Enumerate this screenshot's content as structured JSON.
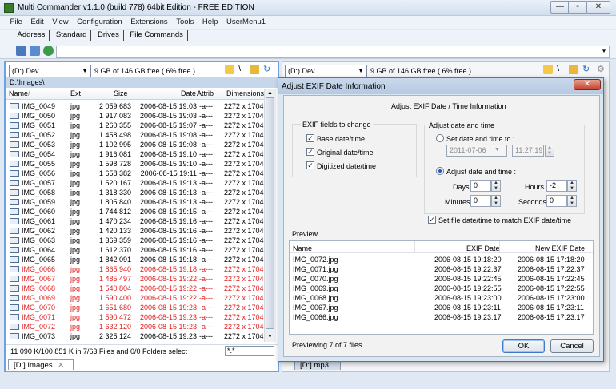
{
  "window": {
    "title": "Multi Commander v1.1.0 (build 778) 64bit Edition - FREE EDITION",
    "min_glyph": "—",
    "max_glyph": "▫",
    "close_glyph": "✕"
  },
  "menu": [
    "File",
    "Edit",
    "View",
    "Configuration",
    "Extensions",
    "Tools",
    "Help",
    "UserMenu1"
  ],
  "toolbar_tabs": [
    "Address",
    "Standard",
    "Drives",
    "File Commands"
  ],
  "left_panel": {
    "drive": "(D:) Dev",
    "free": "9 GB of 146 GB free ( 6% free )",
    "path": "D:\\Images\\",
    "columns": [
      "Name",
      "Ext",
      "Size",
      "Date",
      "Attrib",
      "Dimensions"
    ],
    "sort_glyph": "/",
    "files": [
      {
        "name": "IMG_0049",
        "ext": "jpg",
        "size": "2 059 683",
        "date": "2006-08-15 19:03",
        "attrib": "-a---",
        "dim": "2272 x 1704",
        "red": false
      },
      {
        "name": "IMG_0050",
        "ext": "jpg",
        "size": "1 917 083",
        "date": "2006-08-15 19:03",
        "attrib": "-a---",
        "dim": "2272 x 1704",
        "red": false
      },
      {
        "name": "IMG_0051",
        "ext": "jpg",
        "size": "1 260 355",
        "date": "2006-08-15 19:07",
        "attrib": "-a---",
        "dim": "2272 x 1704",
        "red": false
      },
      {
        "name": "IMG_0052",
        "ext": "jpg",
        "size": "1 458 498",
        "date": "2006-08-15 19:08",
        "attrib": "-a---",
        "dim": "2272 x 1704",
        "red": false
      },
      {
        "name": "IMG_0053",
        "ext": "jpg",
        "size": "1 102 995",
        "date": "2006-08-15 19:08",
        "attrib": "-a---",
        "dim": "2272 x 1704",
        "red": false
      },
      {
        "name": "IMG_0054",
        "ext": "jpg",
        "size": "1 916 081",
        "date": "2006-08-15 19:10",
        "attrib": "-a---",
        "dim": "2272 x 1704",
        "red": false
      },
      {
        "name": "IMG_0055",
        "ext": "jpg",
        "size": "1 598 728",
        "date": "2006-08-15 19:10",
        "attrib": "-a---",
        "dim": "2272 x 1704",
        "red": false
      },
      {
        "name": "IMG_0056",
        "ext": "jpg",
        "size": "1 658 382",
        "date": "2006-08-15 19:11",
        "attrib": "-a---",
        "dim": "2272 x 1704",
        "red": false
      },
      {
        "name": "IMG_0057",
        "ext": "jpg",
        "size": "1 520 167",
        "date": "2006-08-15 19:13",
        "attrib": "-a---",
        "dim": "2272 x 1704",
        "red": false
      },
      {
        "name": "IMG_0058",
        "ext": "jpg",
        "size": "1 318 330",
        "date": "2006-08-15 19:13",
        "attrib": "-a---",
        "dim": "2272 x 1704",
        "red": false
      },
      {
        "name": "IMG_0059",
        "ext": "jpg",
        "size": "1 805 840",
        "date": "2006-08-15 19:13",
        "attrib": "-a---",
        "dim": "2272 x 1704",
        "red": false
      },
      {
        "name": "IMG_0060",
        "ext": "jpg",
        "size": "1 744 812",
        "date": "2006-08-15 19:15",
        "attrib": "-a---",
        "dim": "2272 x 1704",
        "red": false
      },
      {
        "name": "IMG_0061",
        "ext": "jpg",
        "size": "1 470 234",
        "date": "2006-08-15 19:16",
        "attrib": "-a---",
        "dim": "2272 x 1704",
        "red": false
      },
      {
        "name": "IMG_0062",
        "ext": "jpg",
        "size": "1 420 133",
        "date": "2006-08-15 19:16",
        "attrib": "-a---",
        "dim": "2272 x 1704",
        "red": false
      },
      {
        "name": "IMG_0063",
        "ext": "jpg",
        "size": "1 369 359",
        "date": "2006-08-15 19:16",
        "attrib": "-a---",
        "dim": "2272 x 1704",
        "red": false
      },
      {
        "name": "IMG_0064",
        "ext": "jpg",
        "size": "1 612 370",
        "date": "2006-08-15 19:16",
        "attrib": "-a---",
        "dim": "2272 x 1704",
        "red": false
      },
      {
        "name": "IMG_0065",
        "ext": "jpg",
        "size": "1 842 091",
        "date": "2006-08-15 19:18",
        "attrib": "-a---",
        "dim": "2272 x 1704",
        "red": false
      },
      {
        "name": "IMG_0066",
        "ext": "jpg",
        "size": "1 865 940",
        "date": "2006-08-15 19:18",
        "attrib": "-a---",
        "dim": "2272 x 1704",
        "red": true
      },
      {
        "name": "IMG_0067",
        "ext": "jpg",
        "size": "1 485 497",
        "date": "2006-08-15 19:22",
        "attrib": "-a---",
        "dim": "2272 x 1704",
        "red": true
      },
      {
        "name": "IMG_0068",
        "ext": "jpg",
        "size": "1 540 804",
        "date": "2006-08-15 19:22",
        "attrib": "-a---",
        "dim": "2272 x 1704",
        "red": true
      },
      {
        "name": "IMG_0069",
        "ext": "jpg",
        "size": "1 590 400",
        "date": "2006-08-15 19:22",
        "attrib": "-a---",
        "dim": "2272 x 1704",
        "red": true
      },
      {
        "name": "IMG_0070",
        "ext": "jpg",
        "size": "1 651 680",
        "date": "2006-08-15 19:23",
        "attrib": "-a---",
        "dim": "2272 x 1704",
        "red": true
      },
      {
        "name": "IMG_0071",
        "ext": "jpg",
        "size": "1 590 472",
        "date": "2006-08-15 19:23",
        "attrib": "-a---",
        "dim": "2272 x 1704",
        "red": true
      },
      {
        "name": "IMG_0072",
        "ext": "jpg",
        "size": "1 632 120",
        "date": "2006-08-15 19:23",
        "attrib": "-a---",
        "dim": "2272 x 1704",
        "red": true
      },
      {
        "name": "IMG_0073",
        "ext": "jpg",
        "size": "2 325 124",
        "date": "2006-08-15 19:23",
        "attrib": "-a---",
        "dim": "2272 x 1704",
        "red": false
      }
    ],
    "status": "11 090 K/100 851 K in 7/63 Files and 0/0 Folders select",
    "filter": "*.*",
    "tab": "[D:] Images",
    "tab_close": "✕"
  },
  "right_panel": {
    "drive": "(D:) Dev",
    "free": "9 GB of 146 GB free ( 6% free )",
    "tab": "[D:] mp3"
  },
  "dialog": {
    "title": "Adjust EXIF Date Information",
    "heading": "Adjust EXIF Date / Time Information",
    "fields_group": "EXIF fields to change",
    "fields": [
      {
        "label": "Base date/time",
        "checked": true
      },
      {
        "label": "Original date/time",
        "checked": true
      },
      {
        "label": "Digitized date/time",
        "checked": true
      }
    ],
    "adjust_group": "Adjust date and time",
    "set_radio": "Set date and time to :",
    "set_date": "2011-07-06",
    "set_time": "11:27:19",
    "adjust_radio": "Adjust date and time :",
    "days_label": "Days",
    "days": "0",
    "hours_label": "Hours",
    "hours": "-2",
    "minutes_label": "Minutes",
    "minutes": "0",
    "seconds_label": "Seconds",
    "seconds": "0",
    "match_label": "Set file date/time to match EXIF date/time",
    "preview_label": "Preview",
    "preview_columns": [
      "Name",
      "EXIF Date",
      "New EXIF Date"
    ],
    "preview_rows": [
      {
        "name": "IMG_0072.jpg",
        "exif": "2006-08-15 19:18:20",
        "new": "2006-08-15 17:18:20"
      },
      {
        "name": "IMG_0071.jpg",
        "exif": "2006-08-15 19:22:37",
        "new": "2006-08-15 17:22:37"
      },
      {
        "name": "IMG_0070.jpg",
        "exif": "2006-08-15 19:22:45",
        "new": "2006-08-15 17:22:45"
      },
      {
        "name": "IMG_0069.jpg",
        "exif": "2006-08-15 19:22:55",
        "new": "2006-08-15 17:22:55"
      },
      {
        "name": "IMG_0068.jpg",
        "exif": "2006-08-15 19:23:00",
        "new": "2006-08-15 17:23:00"
      },
      {
        "name": "IMG_0067.jpg",
        "exif": "2006-08-15 19:23:11",
        "new": "2006-08-15 17:23:11"
      },
      {
        "name": "IMG_0066.jpg",
        "exif": "2006-08-15 19:23:17",
        "new": "2006-08-15 17:23:17"
      }
    ],
    "status": "Previewing 7 of 7 files",
    "ok": "OK",
    "cancel": "Cancel",
    "close_glyph": "✕"
  },
  "colors": {
    "accent": "#6fa0e0",
    "marked_file": "#e02020",
    "dialog_bg": "#f2f2f2"
  }
}
